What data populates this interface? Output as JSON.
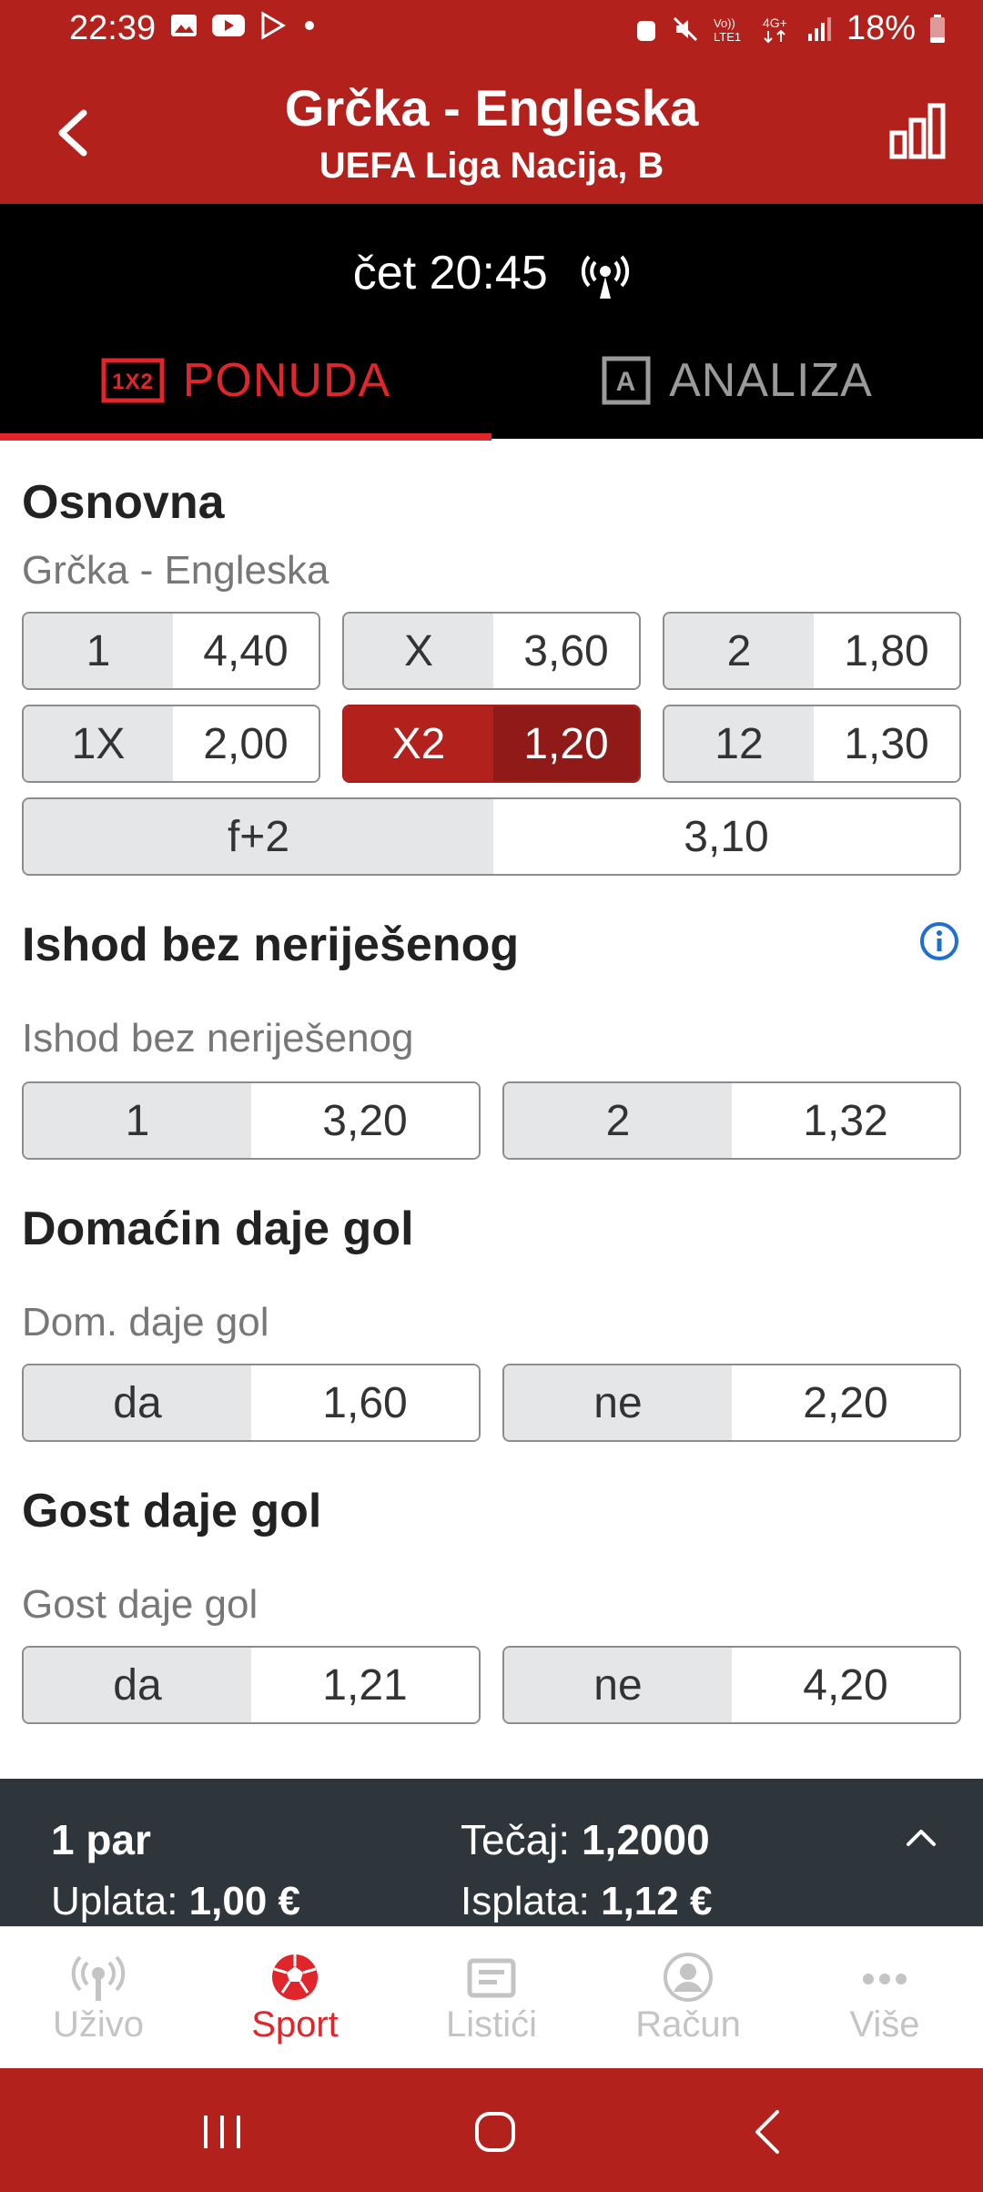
{
  "status_bar": {
    "time": "22:39",
    "battery": "18%"
  },
  "header": {
    "title": "Grčka - Engleska",
    "subtitle": "UEFA Liga Nacija, B"
  },
  "match": {
    "kickoff": "čet 20:45"
  },
  "tabs": [
    {
      "label": "PONUDA",
      "icon_text": "1X2",
      "active": true
    },
    {
      "label": "ANALIZA",
      "icon_text": "A",
      "active": false
    }
  ],
  "sections": {
    "osnovna": {
      "title": "Osnovna",
      "subtitle": "Grčka - Engleska",
      "row1": [
        {
          "label": "1",
          "odd": "4,40"
        },
        {
          "label": "X",
          "odd": "3,60"
        },
        {
          "label": "2",
          "odd": "1,80"
        }
      ],
      "row2": [
        {
          "label": "1X",
          "odd": "2,00"
        },
        {
          "label": "X2",
          "odd": "1,20",
          "selected": true
        },
        {
          "label": "12",
          "odd": "1,30"
        }
      ],
      "row3": {
        "label": "f+2",
        "odd": "3,10"
      }
    },
    "ishod": {
      "title": "Ishod bez neriješenog",
      "subtitle": "Ishod bez neriješenog",
      "options": [
        {
          "label": "1",
          "odd": "3,20"
        },
        {
          "label": "2",
          "odd": "1,32"
        }
      ]
    },
    "domacin": {
      "title": "Domaćin daje gol",
      "subtitle": "Dom. daje gol",
      "options": [
        {
          "label": "da",
          "odd": "1,60"
        },
        {
          "label": "ne",
          "odd": "2,20"
        }
      ]
    },
    "gost": {
      "title": "Gost daje gol",
      "subtitle": "Gost daje gol",
      "options": [
        {
          "label": "da",
          "odd": "1,21"
        },
        {
          "label": "ne",
          "odd": "4,20"
        }
      ]
    }
  },
  "betslip": {
    "pairs": "1 par",
    "uplata_label": "Uplata:",
    "uplata_value": "1,00 €",
    "tecaj_label": "Tečaj:",
    "tecaj_value": "1,2000",
    "isplata_label": "Isplata:",
    "isplata_value": "1,12 €"
  },
  "bottom_nav": [
    {
      "label": "Uživo",
      "icon": "live-icon"
    },
    {
      "label": "Sport",
      "icon": "soccer-ball-icon",
      "active": true
    },
    {
      "label": "Listići",
      "icon": "ticket-icon"
    },
    {
      "label": "Račun",
      "icon": "account-icon"
    },
    {
      "label": "Više",
      "icon": "more-icon"
    }
  ],
  "colors": {
    "brand_red": "#b3211c",
    "accent_red": "#e0262a",
    "selected_dark": "#8f1a17",
    "betslip_bg": "#2f363b"
  }
}
